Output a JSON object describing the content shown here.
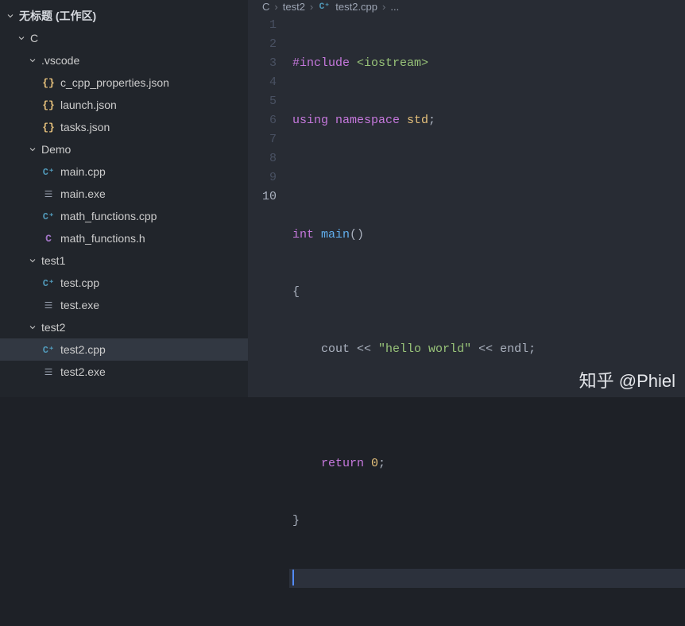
{
  "sidebar": {
    "header": "无标题 (工作区)",
    "root": "C",
    "folders": {
      "vscode": ".vscode",
      "demo": "Demo",
      "test1": "test1",
      "test2": "test2"
    },
    "files": {
      "ccpp": "c_cpp_properties.json",
      "launch": "launch.json",
      "tasks": "tasks.json",
      "main_cpp": "main.cpp",
      "main_exe": "main.exe",
      "mathf_cpp": "math_functions.cpp",
      "mathf_h": "math_functions.h",
      "test_cpp": "test.cpp",
      "test_exe": "test.exe",
      "test2_cpp": "test2.cpp",
      "test2_exe": "test2.exe"
    }
  },
  "breadcrumb": {
    "b0": "C",
    "b1": "test2",
    "b2": "test2.cpp",
    "b3": "..."
  },
  "code": {
    "gutter": [
      "1",
      "2",
      "3",
      "4",
      "5",
      "6",
      "7",
      "8",
      "9",
      "10"
    ],
    "tokens": {
      "include": "#include",
      "iostream": " <iostream>",
      "using": "using",
      "namespace": " namespace",
      "std": " std",
      "semi": ";",
      "int": "int",
      "main": " main",
      "parens": "()",
      "lbrace": "{",
      "cout": "cout",
      "lshift1": " << ",
      "hello": "\"hello world\"",
      "lshift2": " << ",
      "endl": "endl",
      "return": "return",
      "zero": " 0",
      "rbrace": "}"
    }
  },
  "watermark": "知乎 @Phiel"
}
